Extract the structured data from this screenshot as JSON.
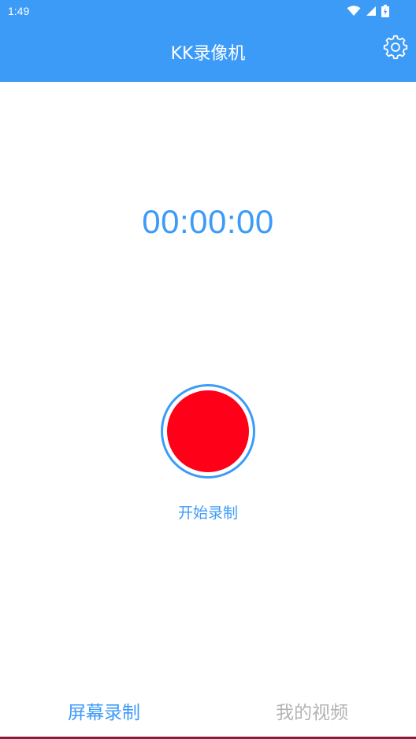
{
  "status_bar": {
    "time": "1:49",
    "icons": [
      "wifi-icon",
      "signal-icon",
      "battery-charging-icon"
    ]
  },
  "header": {
    "title": "KK录像机",
    "settings_icon": "gear-icon"
  },
  "recorder": {
    "timer": "00:00:00",
    "record_label": "开始录制"
  },
  "tabs": [
    {
      "label": "屏幕录制",
      "active": true
    },
    {
      "label": "我的视频",
      "active": false
    }
  ],
  "colors": {
    "accent": "#3d9bf8",
    "record": "#ff0019",
    "inactive_tab": "#b3b3b3"
  }
}
